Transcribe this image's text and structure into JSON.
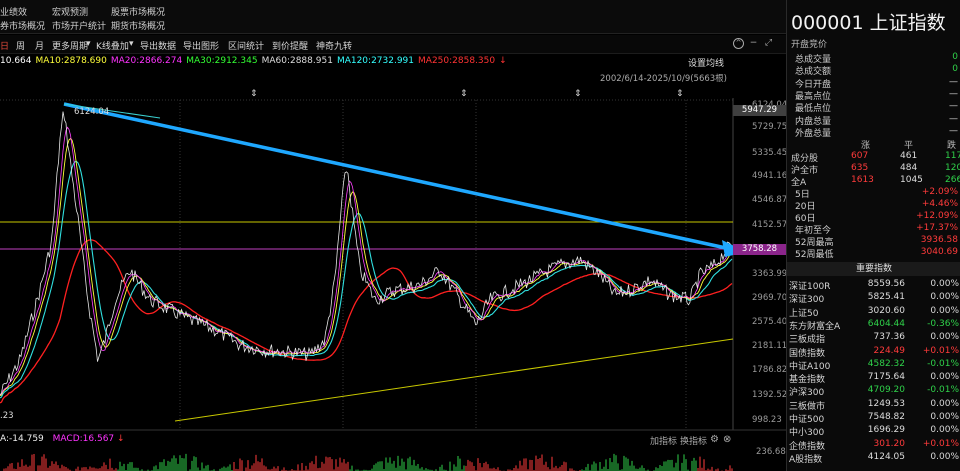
{
  "top_menu": [
    {
      "label": "业绩效"
    },
    {
      "label": "宏观预测"
    },
    {
      "label": "股票市场概况"
    },
    {
      "label": "券市场概况"
    },
    {
      "label": "市场开户统计"
    },
    {
      "label": "期货市场概况"
    }
  ],
  "toolbar": {
    "items": [
      "日",
      "周",
      "月",
      "更多周期",
      "K线叠加",
      "导出数据",
      "导出图形",
      "区间统计",
      "到价提醒",
      "神奇九转"
    ],
    "more_arrow": "▾",
    "kline_arrow": "▾"
  },
  "ma_legend": [
    {
      "text": "10.664",
      "color": "#ffffff"
    },
    {
      "text": "MA10:2878.690",
      "color": "#ffff3a"
    },
    {
      "text": "MA20:2866.274",
      "color": "#ff33ff"
    },
    {
      "text": "MA30:2912.345",
      "color": "#33ff33"
    },
    {
      "text": "MA60:2888.951",
      "color": "#dddddd"
    },
    {
      "text": "MA120:2732.991",
      "color": "#33ffff"
    },
    {
      "text": "MA250:2858.350",
      "color": "#ff3333"
    }
  ],
  "ma_arrow": "↓",
  "settings_ma": "设置均线",
  "date_range": "2002/6/14-2025/10/9(5663根)",
  "y_axis": [
    "6124.04",
    "5729.75",
    "5335.45",
    "4941.16",
    "4546.87",
    "4152.57",
    "3363.99",
    "2969.70",
    "2575.40",
    "2181.11",
    "1786.82",
    "1392.52",
    "998.23"
  ],
  "y_box_top": "5947.29",
  "y_box_mid": "3758.28",
  "peak_label": "6124.04",
  "low_label": ".23",
  "bottom": {
    "left_val": "A:-14.759",
    "macd": "MACD:16.567",
    "macd_arrow": "↓",
    "add_indicator": "加指标",
    "switch_indicator": "换指标",
    "right_axis_top": "236.68"
  },
  "right_panel": {
    "code": "000001",
    "name": "上证指数",
    "sub": "开盘竞价",
    "fields": [
      {
        "label": "总成交量",
        "value": "0"
      },
      {
        "label": "总成交额",
        "value": "0"
      },
      {
        "label": "今日开盘",
        "value": "—"
      },
      {
        "label": "最高点位",
        "value": "—"
      },
      {
        "label": "最低点位",
        "value": "—"
      },
      {
        "label": "内盘总量",
        "value": "—"
      },
      {
        "label": "外盘总量",
        "value": "—"
      }
    ],
    "breadth_header": [
      "涨",
      "平",
      "跌"
    ],
    "breadth": [
      {
        "label": "成分股",
        "up": "607",
        "flat": "461",
        "down": "117"
      },
      {
        "label": "沪全市",
        "up": "635",
        "flat": "484",
        "down": "120"
      },
      {
        "label": "全A",
        "up": "1613",
        "flat": "1045",
        "down": "266"
      }
    ],
    "periods": [
      {
        "label": "5日",
        "value": "+2.09%"
      },
      {
        "label": "20日",
        "value": "+4.46%"
      },
      {
        "label": "60日",
        "value": "+12.09%"
      },
      {
        "label": "年初至今",
        "value": "+17.37%"
      },
      {
        "label": "52周最高",
        "value": "3936.58"
      },
      {
        "label": "52周最低",
        "value": "3040.69"
      }
    ],
    "section_title": "重要指数",
    "indices": [
      {
        "name": "深证100R",
        "value": "8559.56",
        "change": "0.00%",
        "dir": "eq"
      },
      {
        "name": "深证300",
        "value": "5825.41",
        "change": "0.00%",
        "dir": "eq"
      },
      {
        "name": "上证50",
        "value": "3020.60",
        "change": "0.00%",
        "dir": "eq"
      },
      {
        "name": "东方财富全A",
        "value": "6404.44",
        "change": "-0.36%",
        "dir": "dn"
      },
      {
        "name": "三板成指",
        "value": "737.36",
        "change": "0.00%",
        "dir": "eq"
      },
      {
        "name": "国债指数",
        "value": "224.49",
        "change": "+0.01%",
        "dir": "up"
      },
      {
        "name": "中证A100",
        "value": "4582.32",
        "change": "-0.01%",
        "dir": "dn"
      },
      {
        "name": "基金指数",
        "value": "7175.64",
        "change": "0.00%",
        "dir": "eq"
      },
      {
        "name": "沪深300",
        "value": "4709.20",
        "change": "-0.01%",
        "dir": "dn"
      },
      {
        "name": "三板做市",
        "value": "1249.53",
        "change": "0.00%",
        "dir": "eq"
      },
      {
        "name": "中证500",
        "value": "7548.82",
        "change": "0.00%",
        "dir": "eq"
      },
      {
        "name": "中小300",
        "value": "1696.29",
        "change": "0.00%",
        "dir": "eq"
      },
      {
        "name": "企债指数",
        "value": "301.20",
        "change": "+0.01%",
        "dir": "up"
      },
      {
        "name": "A股指数",
        "value": "4124.05",
        "change": "0.00%",
        "dir": "eq"
      }
    ]
  },
  "colors": {
    "up": "#ff3b3b",
    "down": "#2fd14a",
    "trendline": "#1fa8ff",
    "hline_yellow": "#c8c800",
    "hline_magenta": "#c040c0"
  }
}
